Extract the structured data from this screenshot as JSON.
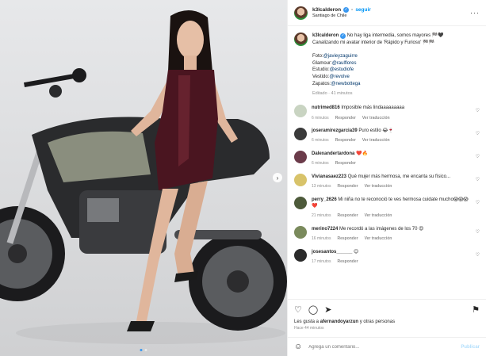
{
  "post_author": {
    "username": "k3lcalderon",
    "follow_label": "seguir",
    "location": "Santiago de Chile"
  },
  "caption": {
    "username": "k3lcalderon",
    "line1": "No hay liga intermedia, somos mayores 🏁🖤",
    "line2": "Canalizando mi avatar interior de 'Rápido y Furioso' 🏁🏁",
    "credits": [
      {
        "label": "Foto:",
        "handle": "@javieyzaguirre"
      },
      {
        "label": "Glamour:",
        "handle": "@raulflores"
      },
      {
        "label": "Estudio:",
        "handle": "@estudiofe"
      },
      {
        "label": "Vestido:",
        "handle": "@revolve"
      },
      {
        "label": "Zapatos:",
        "handle": "@newbottega"
      }
    ],
    "edited": "Editado · 41 minutos"
  },
  "comments": [
    {
      "user": "nutrimed816",
      "text": "Imposible más lindaaaaaaaaa",
      "time": "6 minutos",
      "reply": "Responder",
      "translate": "Ver traducción",
      "color": "#c9d4c2"
    },
    {
      "user": "joseramirezgarcia39",
      "text": "Puro estilo 😂🍷",
      "time": "6 minutos",
      "reply": "Responder",
      "translate": "Ver traducción",
      "color": "#3a3a3a"
    },
    {
      "user": "Dalexandertardona",
      "text": "❤️🔥",
      "time": "6 minutos",
      "reply": "Responder",
      "translate": "",
      "color": "#6b3b4a"
    },
    {
      "user": "Vivianasaez223",
      "text": "Qué mujer más hermosa, me encanta su físico...",
      "time": "13 minutos",
      "reply": "Responder",
      "translate": "Ver traducción",
      "color": "#d8c36a"
    },
    {
      "user": "perry_2626",
      "text": "Mi niña no te reconoció te ves hermosa cuidate mucho😱😱😱❤️",
      "time": "21 minutos",
      "reply": "Responder",
      "translate": "Ver traducción",
      "color": "#4d5a3a"
    },
    {
      "user": "merino7224",
      "text": "Me recordó a las imágenes de los 70 😍",
      "time": "16 minutos",
      "reply": "Responder",
      "translate": "Ver traducción",
      "color": "#7a8a5c"
    },
    {
      "user": "josesantos______",
      "text": "😊",
      "time": "17 minutos",
      "reply": "Responder",
      "translate": "",
      "color": "#2a2a2a"
    }
  ],
  "likes": {
    "prefix": "Les gusta a",
    "user": "afernandoyarzun",
    "suffix": "y otras personas"
  },
  "posted_time": "Hace 44 minutos",
  "add_comment": {
    "placeholder": "Agrega un comentario...",
    "post_label": "Publicar"
  },
  "colors": {
    "accent": "#0095f6",
    "muted": "#8e8e8e"
  }
}
